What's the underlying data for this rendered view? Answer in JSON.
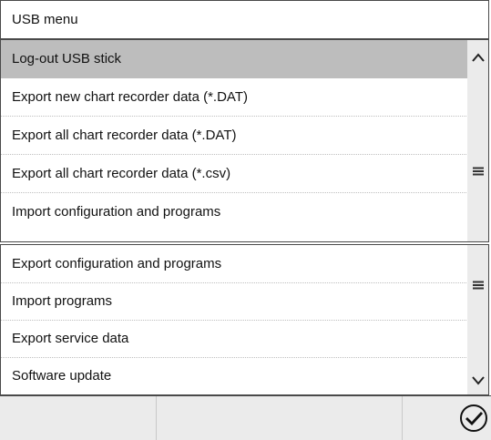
{
  "header": {
    "title": "USB menu"
  },
  "panel1": {
    "items": [
      "Log-out USB stick",
      "Export new chart recorder data (*.DAT)",
      "Export all chart recorder data (*.DAT)",
      "Export all chart recorder data (*.csv)",
      "Import configuration and programs"
    ]
  },
  "panel2": {
    "items": [
      "Export configuration and programs",
      "Import programs",
      "Export service data",
      "Software update"
    ]
  },
  "colors": {
    "selected": "#bdbdbd",
    "scrollbar": "#ebebeb",
    "border": "#4a4a4a"
  },
  "icons": {
    "scroll_up": "chevron-up-icon",
    "scroll_thumb": "menu-icon",
    "scroll_down": "chevron-down-icon",
    "confirm": "check-circle-icon"
  }
}
